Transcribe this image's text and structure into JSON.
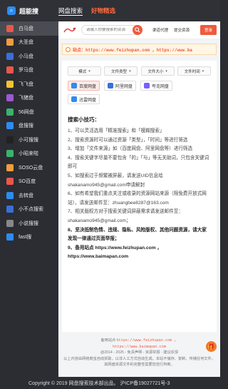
{
  "brand": {
    "name": "超能搜"
  },
  "top_tabs": [
    {
      "label": "网盘搜索"
    },
    {
      "label": "好物精选"
    }
  ],
  "sidebar": {
    "items": [
      {
        "label": "白马盘",
        "icon": "horse-icon",
        "color": "#e8584a"
      },
      {
        "label": "大圣盘",
        "icon": "monkey-icon",
        "color": "#f39c3d"
      },
      {
        "label": "小马盘",
        "icon": "pony-icon",
        "color": "#3a6fd8"
      },
      {
        "label": "罗马盘",
        "icon": "rome-icon",
        "color": "#e8584a"
      },
      {
        "label": "飞飞盘",
        "icon": "plane-icon",
        "color": "#f2c230"
      },
      {
        "label": "飞猪盘",
        "icon": "pig-icon",
        "color": "#9b59d0"
      },
      {
        "label": "56网盘",
        "icon": "number-icon",
        "color": "#3bb36b"
      },
      {
        "label": "盘搜搜",
        "icon": "search-disk-icon",
        "color": "#2d8cf0"
      },
      {
        "label": "小可搜搜",
        "icon": "k-icon",
        "color": "#222222"
      },
      {
        "label": "小昭来啦",
        "icon": "z-icon",
        "color": "#3bb36b"
      },
      {
        "label": "SOSO云盘",
        "icon": "soso-icon",
        "color": "#f39c3d"
      },
      {
        "label": "SO百度",
        "icon": "so-icon",
        "color": "#e8584a"
      },
      {
        "label": "去转盘",
        "icon": "transfer-icon",
        "color": "#2d8cf0"
      },
      {
        "label": "小不点搜索",
        "icon": "dot-icon",
        "color": "#3a6fd8"
      },
      {
        "label": "小说搜搜",
        "icon": "book-icon",
        "color": "#888888"
      },
      {
        "label": "fast搜",
        "icon": "fast-icon",
        "color": "#2d8cf0"
      }
    ]
  },
  "header": {
    "search_placeholder": "请输入你要搜索的资源",
    "links": [
      "渠道代理",
      "提交资源"
    ],
    "login_label": "登录"
  },
  "notice": {
    "text": "站点：https://www.feizhupan.com ，https://www.ba"
  },
  "filters": [
    {
      "label": "模式"
    },
    {
      "label": "文件类型"
    },
    {
      "label": "文件大小"
    },
    {
      "label": "文件时间"
    }
  ],
  "disks": [
    {
      "label": "百度网盘",
      "color": "#2d8cf0",
      "selected": true
    },
    {
      "label": "阿里网盘",
      "color": "#3a6fd8",
      "selected": false
    },
    {
      "label": "夸克网盘",
      "color": "#7b5cff",
      "selected": false
    },
    {
      "label": "迅雷网盘",
      "color": "#2d8cf0",
      "selected": false
    }
  ],
  "tips": {
    "title": "搜索小技巧：",
    "items": [
      "1、可以灵活选用「精准搜索」和「模糊搜索」",
      "2、搜索资源时可以通过资源「类型」，「时间」等进行筛选",
      "3、增加「文件来源」如（百度网盘、阿里网盘等）进行筛选",
      "4、搜索关键字尽量不要包含「的」「与」等无关助词，只包含关键词即可",
      "5、如搜索过于频繁被屏蔽，请发送UID信息给shakanamo945@gmail.com申请解封",
      "6、如有希望我们重点关注或收录的资源网站来源（限免费开放式网站），请发送邮件至：zhuangbee8287@163.com",
      "7、相关版权方对于搜索关键词屏蔽需求请发送邮件至：shakanamo945@gmail.com；",
      "8、坚决抵制色情、违规、隐私、风险版权、其他问题资源，请大家发现一律通过页面举报；",
      "9、备用站点 https://www.feizhupan.com ，https://www.baimapan.com"
    ]
  },
  "footer": {
    "mirror_prefix": "备用站点",
    "mirror_1": "https://www.feizhupan.com ，",
    "mirror_2": "https://www.baimapan.com",
    "copyright_line": "@2014 - 2025 - 免责声明 - 资源举报 - 建议反馈",
    "disclaimer": "以上内容由网络爬虫自动抓取，以非人工方式自动生成。本站不储存、复制、传播任何文件，其网盘资源文件的完整性需要您自行判断。"
  },
  "bottombar": {
    "text": "Copyright © 2019 网盘搜索技术部出品。 沪ICP备19027721号-3"
  }
}
